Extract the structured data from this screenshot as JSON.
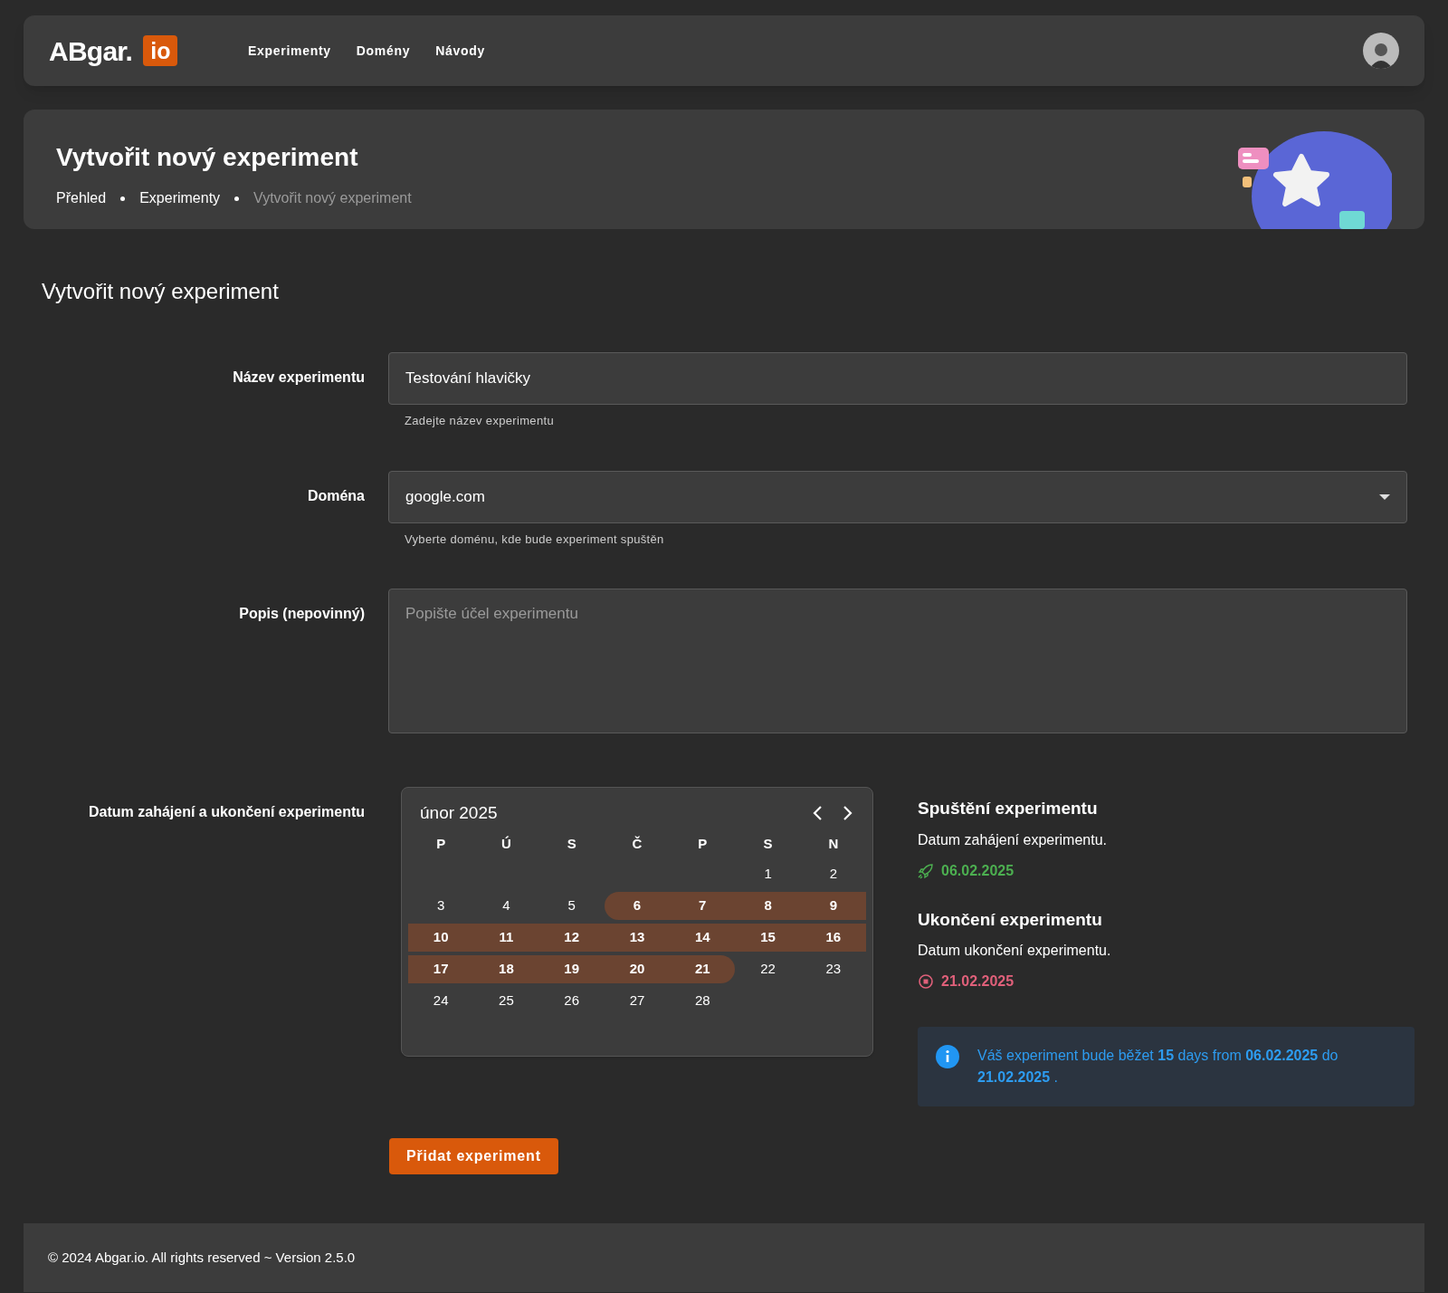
{
  "navbar": {
    "logo": "ABgar.",
    "logo_badge": "io",
    "links": [
      {
        "label": "Experimenty"
      },
      {
        "label": "Domény"
      },
      {
        "label": "Návody"
      }
    ]
  },
  "header": {
    "title": "Vytvořit nový experiment",
    "breadcrumbs": [
      {
        "label": "Přehled",
        "current": false
      },
      {
        "label": "Experimenty",
        "current": false
      },
      {
        "label": "Vytvořit nový experiment",
        "current": true
      }
    ]
  },
  "form": {
    "title": "Vytvořit nový experiment",
    "fields": [
      {
        "kind": "text",
        "label": "Název experimentu",
        "value": "Testování hlavičky",
        "hint": "Zadejte název experimentu"
      },
      {
        "kind": "select",
        "label": "Doména",
        "value": "google.com",
        "hint": "Vyberte doménu, kde bude experiment spuštěn"
      },
      {
        "kind": "textarea",
        "label": "Popis (nepovinný)",
        "placeholder": "Popište účel experimentu"
      }
    ],
    "date_label": "Datum zahájení a ukončení experimentu",
    "calendar": {
      "month": "únor 2025",
      "weekdays": [
        "P",
        "Ú",
        "S",
        "Č",
        "P",
        "S",
        "N"
      ],
      "weeks": [
        [
          {
            "day": "1",
            "selected": false
          },
          {
            "day": "2",
            "selected": false
          }
        ],
        [
          {
            "day": "3",
            "selected": false
          },
          {
            "day": "4",
            "selected": false
          },
          {
            "day": "5",
            "selected": false
          },
          {
            "day": "6",
            "selected": true
          },
          {
            "day": "7",
            "selected": true
          },
          {
            "day": "8",
            "selected": true
          },
          {
            "day": "9",
            "selected": true
          }
        ],
        [
          {
            "day": "10",
            "selected": true
          },
          {
            "day": "11",
            "selected": true
          },
          {
            "day": "12",
            "selected": true
          },
          {
            "day": "13",
            "selected": true
          },
          {
            "day": "14",
            "selected": true
          },
          {
            "day": "15",
            "selected": true
          },
          {
            "day": "16",
            "selected": true
          }
        ],
        [
          {
            "day": "17",
            "selected": true
          },
          {
            "day": "18",
            "selected": true
          },
          {
            "day": "19",
            "selected": true
          },
          {
            "day": "20",
            "selected": true
          },
          {
            "day": "21",
            "selected": true
          },
          {
            "day": "22",
            "selected": false
          },
          {
            "day": "23",
            "selected": false
          }
        ],
        [
          {
            "day": "24",
            "selected": false
          },
          {
            "day": "25",
            "selected": false
          },
          {
            "day": "26",
            "selected": false
          },
          {
            "day": "27",
            "selected": false
          },
          {
            "day": "28",
            "selected": false
          }
        ]
      ]
    },
    "start": {
      "title": "Spuštění experimentu",
      "description": "Datum zahájení experimentu.",
      "date": "06.02.2025"
    },
    "end": {
      "title": "Ukončení experimentu",
      "description": "Datum ukončení experimentu.",
      "date": "21.02.2025"
    },
    "info": "Váš experiment bude běžet **15** days from **06.02.2025** do **21.02.2025** .",
    "submit": "Přidat experiment"
  },
  "footer": "© 2024 Abgar.io. All rights reserved ~ Version 2.5.0"
}
